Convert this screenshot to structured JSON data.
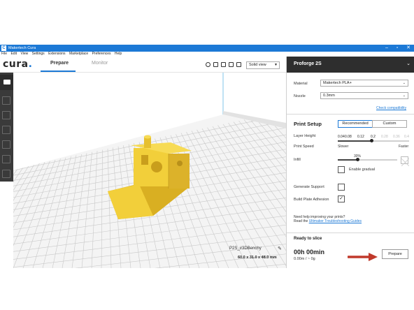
{
  "window": {
    "title": "Makertech Cura",
    "controls": [
      "–",
      "▫",
      "✕"
    ]
  },
  "menu": [
    "File",
    "Edit",
    "View",
    "Settings",
    "Extensions",
    "Marketplace",
    "Preferences",
    "Help"
  ],
  "header": {
    "logo": "cura",
    "tabs": [
      {
        "label": "Prepare",
        "active": true
      },
      {
        "label": "Monitor",
        "active": false
      }
    ],
    "view_mode": "Solid view"
  },
  "viewport": {
    "object_name": "P2S_#3DBenchy",
    "dimensions": "60.0 x 31.0 x 48.0 mm",
    "model_color": "#f2cf3a",
    "plate_color": "#f4f4f4",
    "grid_color": "#c8c8c8"
  },
  "sidebar": {
    "printer": "Proforge 2S",
    "material_label": "Material",
    "material_value": "Makertech PLA+",
    "nozzle_label": "Nozzle",
    "nozzle_value": "0.3mm",
    "check_compat": "Check compatibility",
    "print_setup": "Print Setup",
    "mode_recommended": "Recommended",
    "mode_custom": "Custom",
    "layer_height_label": "Layer Height",
    "layer_heights": [
      "0.04",
      "0.08",
      "0.12",
      "0.2",
      "0.28",
      "0.36",
      "0.4"
    ],
    "layer_height_selected": "0.2",
    "print_speed_label": "Print Speed",
    "speed_slow": "Slower",
    "speed_fast": "Faster",
    "infill_label": "Infill",
    "infill_percent": "30%",
    "infill_value": 0.3,
    "enable_gradual": "Enable gradual",
    "generate_support": "Generate Support",
    "build_plate_adhesion": "Build Plate Adhesion",
    "adhesion_checked": "✓",
    "help_line1": "Need help improving your prints?",
    "help_line2_prefix": "Read the ",
    "help_link": "Ultimaker Troubleshooting Guides",
    "ready": "Ready to slice",
    "time": "00h 00min",
    "material_estimate": "0.00m / ~ 0g",
    "prepare_button": "Prepare"
  },
  "colors": {
    "accent": "#1c79d6",
    "arrow": "#c0392b",
    "toolbar_dark": "#3a3a3a"
  }
}
